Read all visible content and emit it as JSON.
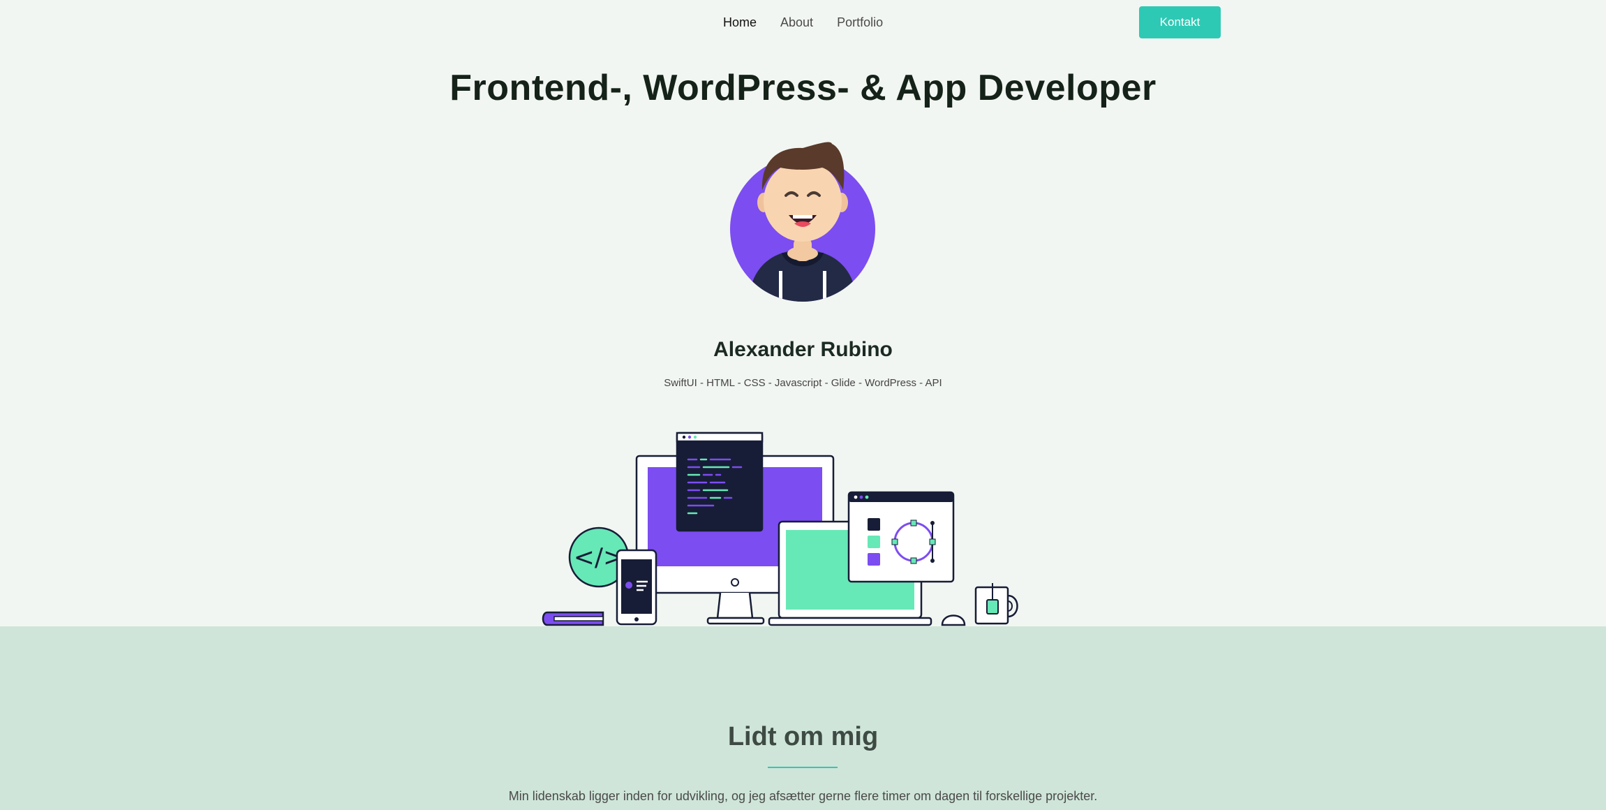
{
  "nav": {
    "links": [
      "Home",
      "About",
      "Portfolio"
    ],
    "active": "Home",
    "cta_label": "Kontakt"
  },
  "hero": {
    "title": "Frontend-, WordPress- & App Developer",
    "avatar_icon": "developer-avatar",
    "name": "Alexander Rubino",
    "skills": "SwiftUI - HTML - CSS - Javascript - Glide - WordPress - API"
  },
  "illustration": {
    "icon": "developer-workspace-illustration",
    "code_badge_text": "</>"
  },
  "about": {
    "title": "Lidt om mig",
    "text": "Min lidenskab ligger inden for udvikling, og jeg afsætter gerne flere timer om dagen til forskellige projekter."
  },
  "colors": {
    "accent": "#2ec9b4",
    "purple": "#7c4df1",
    "mint": "#67e8b7",
    "navy": "#171d36",
    "page_bg": "#f2f6f2",
    "about_bg": "#cfe5d9"
  }
}
